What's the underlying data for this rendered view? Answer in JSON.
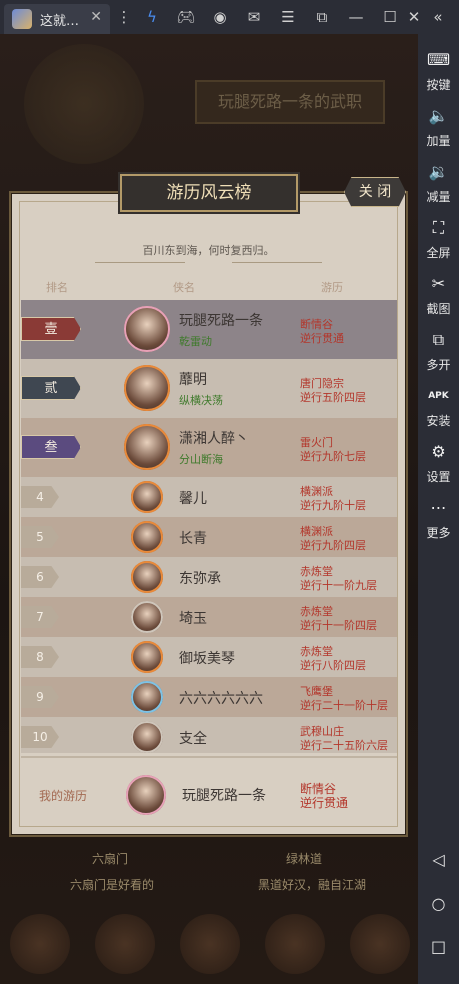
{
  "window": {
    "tab_title": "这就…",
    "tab_close": "✕"
  },
  "toolbar_icons": [
    "more-vert-icon",
    "bolt-icon",
    "gamepad-icon",
    "account-icon",
    "mail-icon",
    "menu-icon",
    "popout-icon",
    "minimize-icon",
    "maximize-icon",
    "close-icon",
    "collapse-icon"
  ],
  "sidebar": {
    "items": [
      {
        "label": "按键",
        "icon": "keyboard-icon",
        "glyph": "⌨"
      },
      {
        "label": "加量",
        "icon": "volume-up-icon",
        "glyph": "🔈"
      },
      {
        "label": "减量",
        "icon": "volume-down-icon",
        "glyph": "🔉"
      },
      {
        "label": "全屏",
        "icon": "fullscreen-icon",
        "glyph": "⛶"
      },
      {
        "label": "截图",
        "icon": "scissors-icon",
        "glyph": "✂"
      },
      {
        "label": "多开",
        "icon": "multi-instance-icon",
        "glyph": "⧉"
      },
      {
        "label": "安装",
        "icon": "apk-install-icon",
        "glyph": "APK"
      },
      {
        "label": "设置",
        "icon": "gear-icon",
        "glyph": "⚙"
      },
      {
        "label": "更多",
        "icon": "more-dots-icon",
        "glyph": "⋯"
      }
    ]
  },
  "background": {
    "banner": "玩腿死路一条的武职",
    "bottom_labels": [
      "六扇门",
      "绿林道",
      "六扇门是好看的",
      "黑道好汉，融自江湖"
    ]
  },
  "modal": {
    "title": "游历风云榜",
    "close_label": "关 闭",
    "subtitle": "百川东到海，何时复西归。",
    "headers": {
      "rank": "排名",
      "hero": "侠名",
      "travel": "游历"
    },
    "rows": [
      {
        "rank": "壹",
        "name": "玩腿死路一条",
        "skill": "乾雷动",
        "loc1": "断情谷",
        "loc2": "逆行贯通",
        "rank_color": "#8a3a36",
        "frame": "#e7a1b7"
      },
      {
        "rank": "贰",
        "name": "蘼明",
        "skill": "纵横决荡",
        "loc1": "唐门隐宗",
        "loc2": "逆行五阶四层",
        "rank_color": "#3f4751",
        "frame": "#e98a3a"
      },
      {
        "rank": "叁",
        "name": "潇湘人醉丶",
        "skill": "分山断海",
        "loc1": "雷火门",
        "loc2": "逆行九阶七层",
        "rank_color": "#5b4b7f",
        "frame": "#e98a3a"
      },
      {
        "rank": "4",
        "name": "馨儿",
        "loc1": "横渊派",
        "loc2": "逆行九阶十层",
        "frame": "#e98a3a"
      },
      {
        "rank": "5",
        "name": "长青",
        "loc1": "横渊派",
        "loc2": "逆行九阶四层",
        "frame": "#e98a3a"
      },
      {
        "rank": "6",
        "name": "东弥承",
        "loc1": "赤炼堂",
        "loc2": "逆行十一阶九层",
        "frame": "#e98a3a"
      },
      {
        "rank": "7",
        "name": "埼玉",
        "loc1": "赤炼堂",
        "loc2": "逆行十一阶四层",
        "frame": "#cfc6bb"
      },
      {
        "rank": "8",
        "name": "御坂美琴",
        "loc1": "赤炼堂",
        "loc2": "逆行八阶四层",
        "frame": "#e98a3a"
      },
      {
        "rank": "9",
        "name": "六六六六六六",
        "loc1": "飞鹰堡",
        "loc2": "逆行二十一阶十层",
        "frame": "#7ec3e6"
      },
      {
        "rank": "10",
        "name": "支全",
        "loc1": "武穆山庄",
        "loc2": "逆行二十五阶六层",
        "frame": "#cfc6bb"
      }
    ],
    "mine": {
      "label": "我的游历",
      "name": "玩腿死路一条",
      "loc1": "断情谷",
      "loc2": "逆行贯通",
      "frame": "#e7a1b7"
    }
  }
}
